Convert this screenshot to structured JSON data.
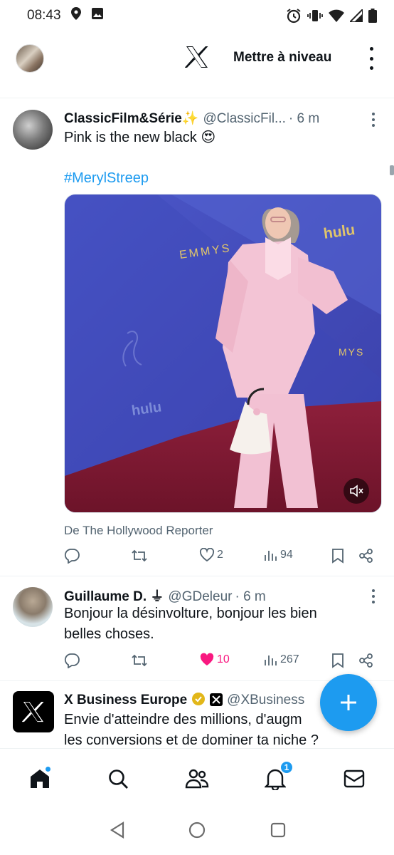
{
  "status_bar": {
    "time": "08:43"
  },
  "top_bar": {
    "upgrade_label": "Mettre à niveau"
  },
  "tweets": [
    {
      "name": "ClassicFilm&Série✨",
      "handle": "@ClassicFil...",
      "time": "· 6 m",
      "text": "Pink is the new black 😍",
      "hashtag": "#MerylStreep",
      "media_texts": {
        "emmys_left": "EMMYS",
        "hulu_right": "hulu",
        "hulu_left": "hulu",
        "emmys_right": "MYS"
      },
      "source": "De The Hollywood Reporter",
      "likes": "2",
      "views": "94"
    },
    {
      "name": "Guillaume D. ⏚",
      "handle": "@GDeleur",
      "time": "· 6 m",
      "text_line1": "Bonjour la désinvolture, bonjour les bien",
      "text_line2": "belles choses.",
      "likes": "10",
      "views": "267"
    },
    {
      "name": "X Business Europe",
      "handle": "@XBusiness",
      "text_line1": "Envie d'atteindre des millions, d'augm",
      "text_line2": "les conversions et de dominer ta niche ?"
    }
  ],
  "bottom_nav": {
    "notifications_count": "1"
  },
  "colors": {
    "accent": "#1d9bf0",
    "like": "#f91880",
    "secondary_text": "#536471"
  }
}
